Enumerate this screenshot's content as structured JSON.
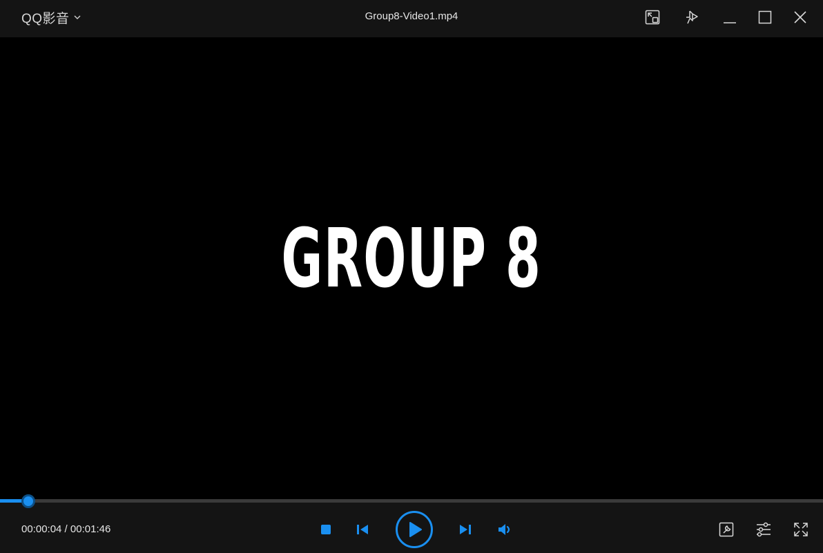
{
  "app": {
    "name": "QQ影音"
  },
  "window": {
    "title": "Group8-Video1.mp4"
  },
  "video": {
    "frame_text": "GROUP 8"
  },
  "playback": {
    "current_time": "00:00:04",
    "total_time": "00:01:46",
    "separator": " / ",
    "progress_fraction": 0.034
  },
  "colors": {
    "accent": "#1a8ff0",
    "bar_bg": "#141414",
    "video_bg": "#000000"
  },
  "icons": {
    "titlebar": [
      "mini-mode-icon",
      "pin-on-top-icon",
      "minimize-icon",
      "maximize-icon",
      "close-icon"
    ],
    "playback": [
      "stop-icon",
      "previous-icon",
      "play-icon",
      "next-icon",
      "volume-icon"
    ],
    "tools": [
      "toolbox-icon",
      "settings-sliders-icon",
      "fullscreen-icon"
    ]
  }
}
